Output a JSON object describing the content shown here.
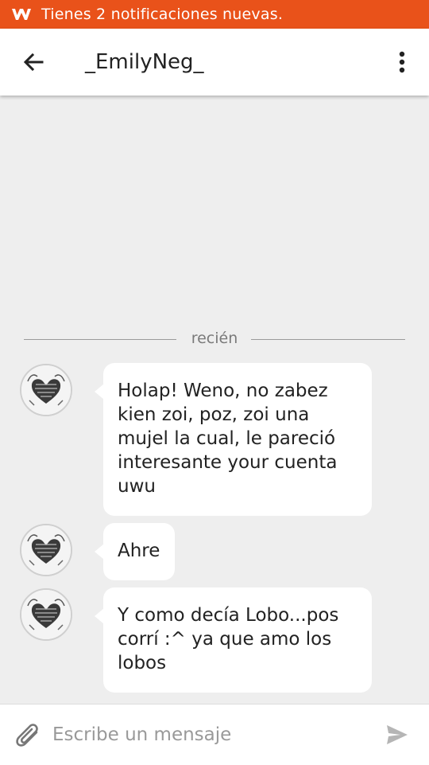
{
  "status_bar": {
    "notification_text": "Tienes 2 notificaciones nuevas.",
    "logo_icon": "wattpad-w-icon",
    "color": "#e9521a"
  },
  "header": {
    "back_icon": "arrow-left-icon",
    "title": "_EmilyNeg_",
    "menu_icon": "more-vert-icon"
  },
  "conversation": {
    "time_divider": "recién",
    "messages": [
      {
        "text": "Holap! Weno, no zabez kien zoi, poz, zoi una mujel la cual, le pareció interesante your cuenta uwu",
        "avatar_icon": "heart-drawing-avatar"
      },
      {
        "text": "Ahre",
        "avatar_icon": "heart-drawing-avatar"
      },
      {
        "text": "Y como decía Lobo...pos corrí :^ ya que amo los lobos",
        "avatar_icon": "heart-drawing-avatar"
      }
    ]
  },
  "composer": {
    "attach_icon": "paperclip-icon",
    "placeholder": "Escribe un mensaje",
    "value": "",
    "send_icon": "send-icon"
  }
}
